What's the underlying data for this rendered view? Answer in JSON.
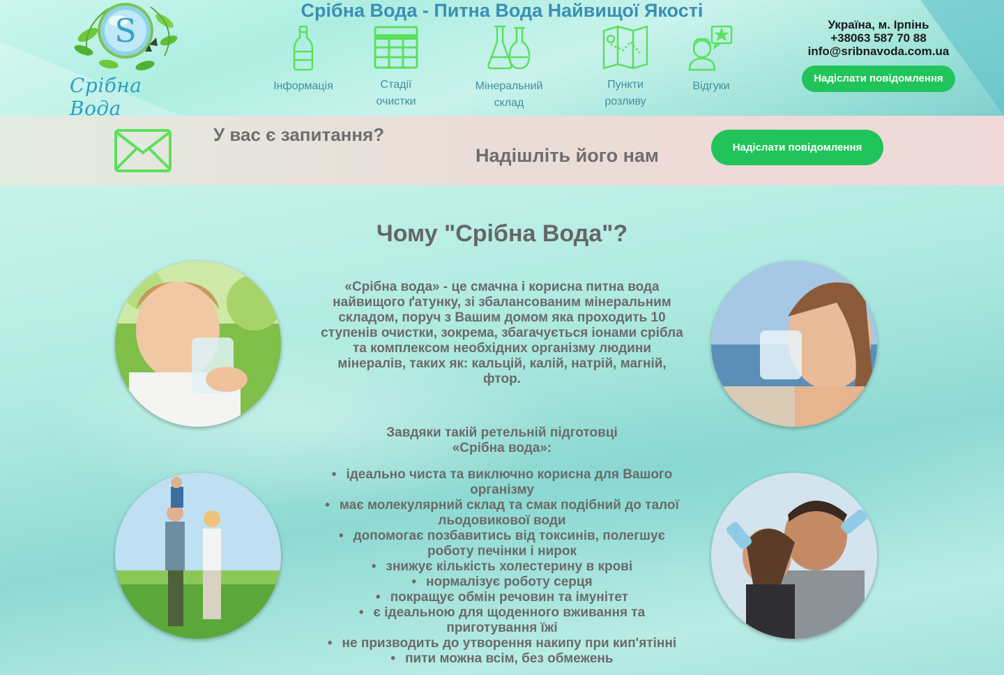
{
  "header": {
    "site_title": "Срібна Вода - Питна Вода Найвищої Якості",
    "logo_letter": "S",
    "logo_text": "Срібна Вода",
    "nav": [
      {
        "label_line1": "Інформація",
        "label_line2": "",
        "icon": "bottle-icon"
      },
      {
        "label_line1": "Стадії",
        "label_line2": "очистки",
        "icon": "grid-icon"
      },
      {
        "label_line1": "Мінеральний",
        "label_line2": "склад",
        "icon": "flask-icon"
      },
      {
        "label_line1": "Пункти",
        "label_line2": "розливу",
        "icon": "map-icon"
      },
      {
        "label_line1": "Відгуки",
        "label_line2": "",
        "icon": "review-icon"
      }
    ],
    "contact": {
      "address": "Україна, м. Ірпінь",
      "phone": "+38063 587 70 88",
      "email": "info@sribnavoda.com.ua"
    },
    "send_button": "Надіслати повідомлення"
  },
  "band": {
    "question": "У вас є запитання?",
    "send_text": "Надішліть його нам",
    "send_button": "Надіслати повідомлення",
    "icon": "envelope-icon"
  },
  "main": {
    "title": "Чому \"Срібна Вода\"?",
    "intro": "«Срібна вода» - це смачна і корисна питна вода найвищого ґатунку, зі збалансованим мінеральним складом, поруч з Вашим домом яка проходить 10 ступенів очистки, зокрема, збагачується іонами срібла та комплексом необхідних організму людини мінералів, таких як: кальцій, калій, натрій, магній, фтор.",
    "thanks_line1": "Завдяки такій ретельній підготовці",
    "thanks_line2": "«Срібна вода»:",
    "benefits": [
      "ідеально чиста та виключно корисна для Вашого організму",
      "має молекулярний склад та смак подібний до талої льодовикової води",
      "допомогає позбавитись від токсинів, полегшує роботу печінки і нирок",
      "знижує кількість холестерину в крові",
      "нормалізує роботу серця",
      "покращує обмін речовин та імунітет",
      "є ідеальною для щоденного вживання та приготування їжі",
      "не призводить до утворення накипу при кип'ятінні",
      "пити можна всім, без обмежень"
    ]
  },
  "colors": {
    "accent_green": "#20c45a",
    "title_blue": "#3a8fb3",
    "icon_green": "#5be05b"
  }
}
